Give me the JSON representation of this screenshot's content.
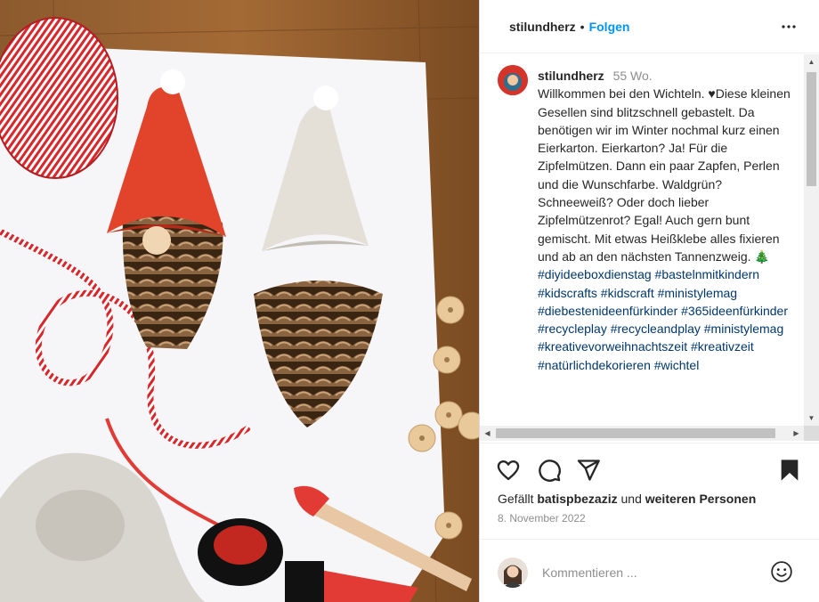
{
  "header": {
    "username": "stilundherz",
    "separator": "•",
    "follow_label": "Folgen",
    "more_icon": "more-horizontal-icon"
  },
  "caption": {
    "username": "stilundherz",
    "time_ago": "55 Wo.",
    "text": "Willkommen bei den Wichteln. ♥Diese kleinen Gesellen sind blitzschnell gebastelt. Da benötigen wir im Winter nochmal kurz einen Eierkarton. Eierkarton? Ja! Für die Zipfelmützen. Dann ein paar Zapfen, Perlen und die Wunschfarbe. Waldgrün? Schneeweiß? Oder doch lieber Zipfelmützenrot? Egal! Auch gern bunt gemischt. Mit etwas Heißklebe alles fixieren und ab an den nächsten Tannenzweig. 🎄",
    "hashtags": "#diyideeboxdienstag #bastelnmitkindern #kidscrafts #kidscraft #ministylemag #diebestenideenfürkinder #365ideenfürkinder #recycleplay #recycleandplay #ministylemag #kreativevorweihnachtszeit #kreativzeit #natürlichdekorieren #wichtel"
  },
  "actions": {
    "like_icon": "heart-icon",
    "comment_icon": "comment-icon",
    "share_icon": "share-icon",
    "save_icon": "bookmark-icon"
  },
  "likes": {
    "prefix": "Gefällt",
    "user": "batispbezaziz",
    "middle": "und",
    "others": "weiteren Personen"
  },
  "date": "8. November 2022",
  "comment_box": {
    "placeholder": "Kommentieren ...",
    "emoji_icon": "smiley-icon"
  },
  "colors": {
    "follow": "#0095f6",
    "hashtag": "#00376b",
    "muted": "#8e8e8e"
  }
}
